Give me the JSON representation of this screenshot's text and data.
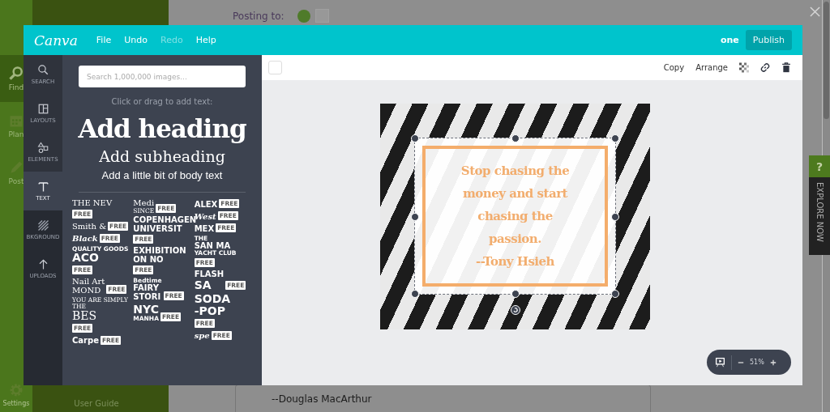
{
  "background_app": {
    "nav": [
      {
        "label": "Find",
        "selected": true
      },
      {
        "label": "Plan",
        "selected": false
      },
      {
        "label": "Post",
        "selected": false
      }
    ],
    "settings": "Settings",
    "posting_to": "Posting to:",
    "user_guide": "User Guide",
    "post_preview": "--Douglas MacArthur"
  },
  "explore_tab": {
    "badge": "?",
    "label": "EXPLORE NOW"
  },
  "editor": {
    "logo": "Canva",
    "menu": [
      {
        "label": "File",
        "disabled": false
      },
      {
        "label": "Undo",
        "disabled": false
      },
      {
        "label": "Redo",
        "disabled": true
      },
      {
        "label": "Help",
        "disabled": false
      }
    ],
    "design_name": "one",
    "publish": "Publish",
    "sidebar": [
      {
        "label": "SEARCH",
        "selected": false
      },
      {
        "label": "LAYOUTS",
        "selected": false
      },
      {
        "label": "ELEMENTS",
        "selected": false
      },
      {
        "label": "TEXT",
        "selected": true
      },
      {
        "label": "BKGROUND",
        "selected": false
      },
      {
        "label": "UPLOADS",
        "selected": false
      }
    ],
    "search": {
      "placeholder": "Search 1,000,000 images..."
    },
    "hint": "Click or drag to add text:",
    "add_heading": "Add heading",
    "add_subheading": "Add subheading",
    "add_body": "Add a little bit of body text",
    "text_presets": [
      [
        {
          "kind": "serif",
          "badge": "FREE",
          "lines": [
            {
              "text": "THE NEV",
              "kind": "main"
            }
          ]
        },
        {
          "kind": "serif",
          "badge": "FREE",
          "lines": [
            {
              "text": "Smith &",
              "kind": "main"
            }
          ]
        },
        {
          "kind": "script",
          "badge": "FREE",
          "lines": [
            {
              "text": "Black",
              "kind": "main"
            }
          ]
        },
        {
          "kind": "sans",
          "badge": "FREE",
          "lines": [
            {
              "text": "QUALITY GOODS",
              "kind": "caption"
            },
            {
              "text": "ACO",
              "kind": "large"
            }
          ]
        },
        {
          "kind": "serif",
          "badge": "FREE",
          "lines": [
            {
              "text": "Nail Art",
              "kind": "main"
            },
            {
              "text": "MOND",
              "kind": "main"
            }
          ]
        },
        {
          "kind": "serif",
          "badge": "FREE",
          "lines": [
            {
              "text": "YOU ARE SIMPLY THE",
              "kind": "caption"
            },
            {
              "text": "BES",
              "kind": "large"
            }
          ]
        },
        {
          "kind": "sans",
          "badge": "FREE",
          "lines": [
            {
              "text": "Carpe",
              "kind": "main"
            }
          ]
        }
      ],
      [
        {
          "kind": "serif",
          "badge": "FREE",
          "lines": [
            {
              "text": "Medi",
              "kind": "main"
            },
            {
              "text": "SINCE",
              "kind": "caption"
            }
          ]
        },
        {
          "kind": "sans",
          "badge": "FREE",
          "lines": [
            {
              "text": "COPENHAGEN",
              "kind": "main"
            },
            {
              "text": "UNIVERSIT",
              "kind": "main"
            }
          ]
        },
        {
          "kind": "sans",
          "badge": "FREE",
          "lines": [
            {
              "text": "EXHIBITION",
              "kind": "main"
            },
            {
              "text": "ON NO",
              "kind": "main"
            }
          ]
        },
        {
          "kind": "sans",
          "badge": "FREE",
          "lines": [
            {
              "text": "Bedtime",
              "kind": "caption"
            },
            {
              "text": "FAIRY",
              "kind": "main"
            },
            {
              "text": "STORI",
              "kind": "main"
            }
          ]
        },
        {
          "kind": "sans",
          "badge": "FREE",
          "lines": [
            {
              "text": "NYC",
              "kind": "large"
            },
            {
              "text": "MANHA",
              "kind": "caption"
            }
          ]
        }
      ],
      [
        {
          "kind": "sans",
          "badge": "FREE",
          "lines": [
            {
              "text": "ALEX",
              "kind": "main"
            }
          ]
        },
        {
          "kind": "script",
          "badge": "FREE",
          "lines": [
            {
              "text": "West",
              "kind": "main"
            }
          ]
        },
        {
          "kind": "sans",
          "badge": "FREE",
          "lines": [
            {
              "text": "MEX",
              "kind": "main"
            }
          ]
        },
        {
          "kind": "sans",
          "badge": "FREE",
          "lines": [
            {
              "text": "THE",
              "kind": "caption"
            },
            {
              "text": "SAN MA",
              "kind": "main"
            },
            {
              "text": "YACHT CLUB",
              "kind": "caption"
            }
          ]
        },
        {
          "kind": "sans",
          "badge": "FREE",
          "lines": [
            {
              "text": "FLASH",
              "kind": "main"
            },
            {
              "text": "SA",
              "kind": "large"
            }
          ]
        },
        {
          "kind": "sans",
          "badge": "FREE",
          "lines": [
            {
              "text": "SODA",
              "kind": "large"
            },
            {
              "text": "-POP",
              "kind": "large"
            }
          ]
        },
        {
          "kind": "script",
          "badge": "FREE",
          "lines": [
            {
              "text": "spe",
              "kind": "main"
            }
          ]
        }
      ]
    ],
    "toolbar": [
      "Copy",
      "Arrange"
    ],
    "quote": {
      "lines": [
        "Stop chasing the",
        "money and start",
        "chasing the",
        "passion.",
        "--Tony Hsieh"
      ]
    },
    "zoom": "51%"
  }
}
